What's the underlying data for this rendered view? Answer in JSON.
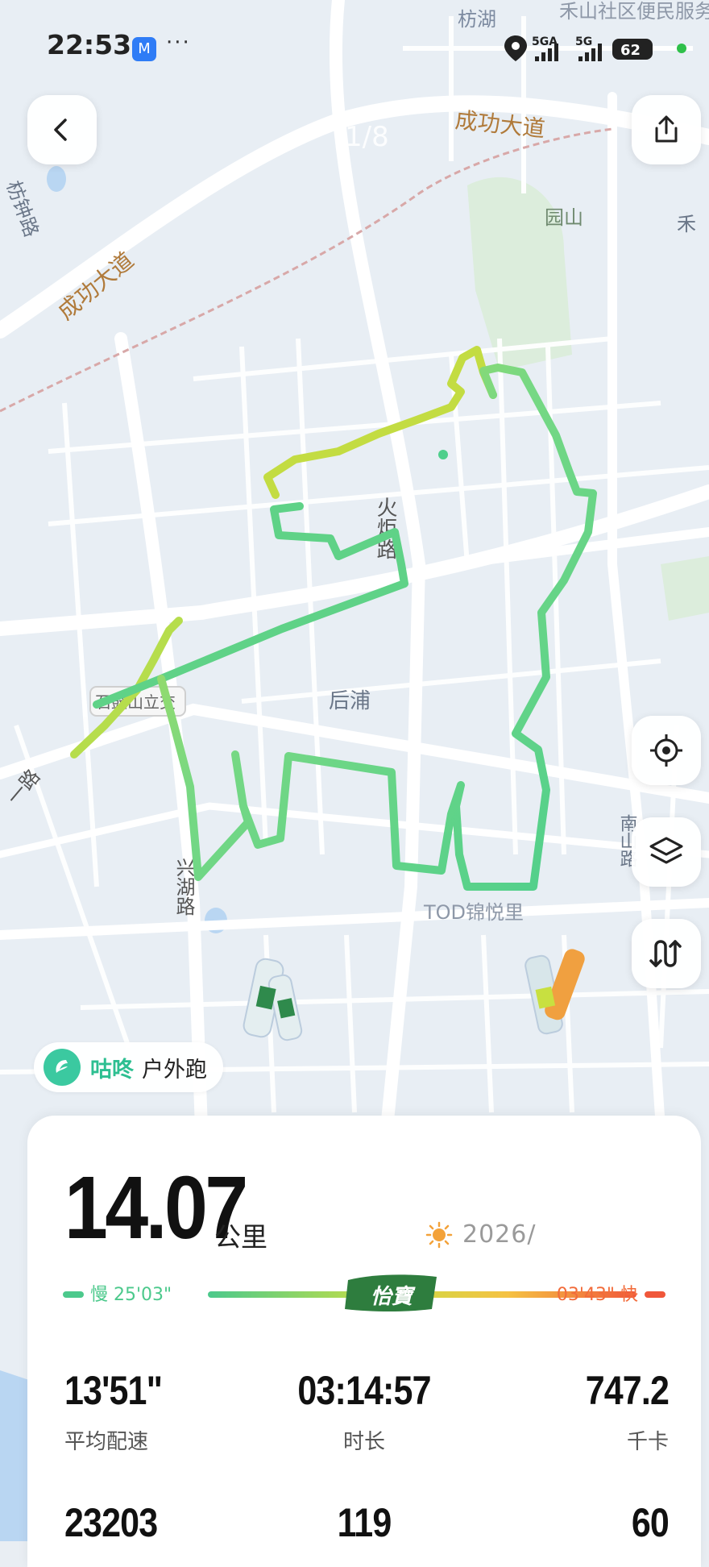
{
  "status_bar": {
    "time": "22:53",
    "app_icon": "M",
    "dots": "···",
    "network_1": "5GA",
    "network_2": "5G",
    "battery": "62"
  },
  "map": {
    "page_counter": "1/8",
    "labels": {
      "fanghu": "枋湖",
      "heshan": "禾山社区便民服务站",
      "chenggong_top": "成功大道",
      "chenggong_left": "成功大道",
      "fangzhong": "枋钟路",
      "yuanshan": "园山",
      "he": "禾",
      "huoju": "火炬路",
      "shixi": "石鼓山立交",
      "houpu": "后浦",
      "xinghu": "兴湖路",
      "tod": "TOD锦悦里",
      "nan": "南山路",
      "yi_lu": "一路"
    }
  },
  "buttons": {
    "back": "back-icon",
    "share": "share-icon",
    "locate": "locate-icon",
    "layers": "layers-icon",
    "route": "route-icon"
  },
  "brand": {
    "name": "咕咚",
    "subtitle": "户外跑"
  },
  "summary": {
    "distance": "14.07",
    "distance_unit": "公里",
    "date": "2026/",
    "pace_slow": "慢 25'03\"",
    "pace_fast": "03'43\" 快",
    "sponsor": "怡寶"
  },
  "stats": [
    {
      "value": "13'51\"",
      "label": "平均配速"
    },
    {
      "value": "03:14:57",
      "label": "时长"
    },
    {
      "value": "747.2",
      "label": "千卡"
    },
    {
      "value": "23203",
      "label": ""
    },
    {
      "value": "119",
      "label": ""
    },
    {
      "value": "60",
      "label": ""
    }
  ],
  "colors": {
    "route_start": "#b6dd4c",
    "route_main": "#5bd490",
    "brand": "#2dbf91",
    "pace_fast": "#f26b3a"
  }
}
